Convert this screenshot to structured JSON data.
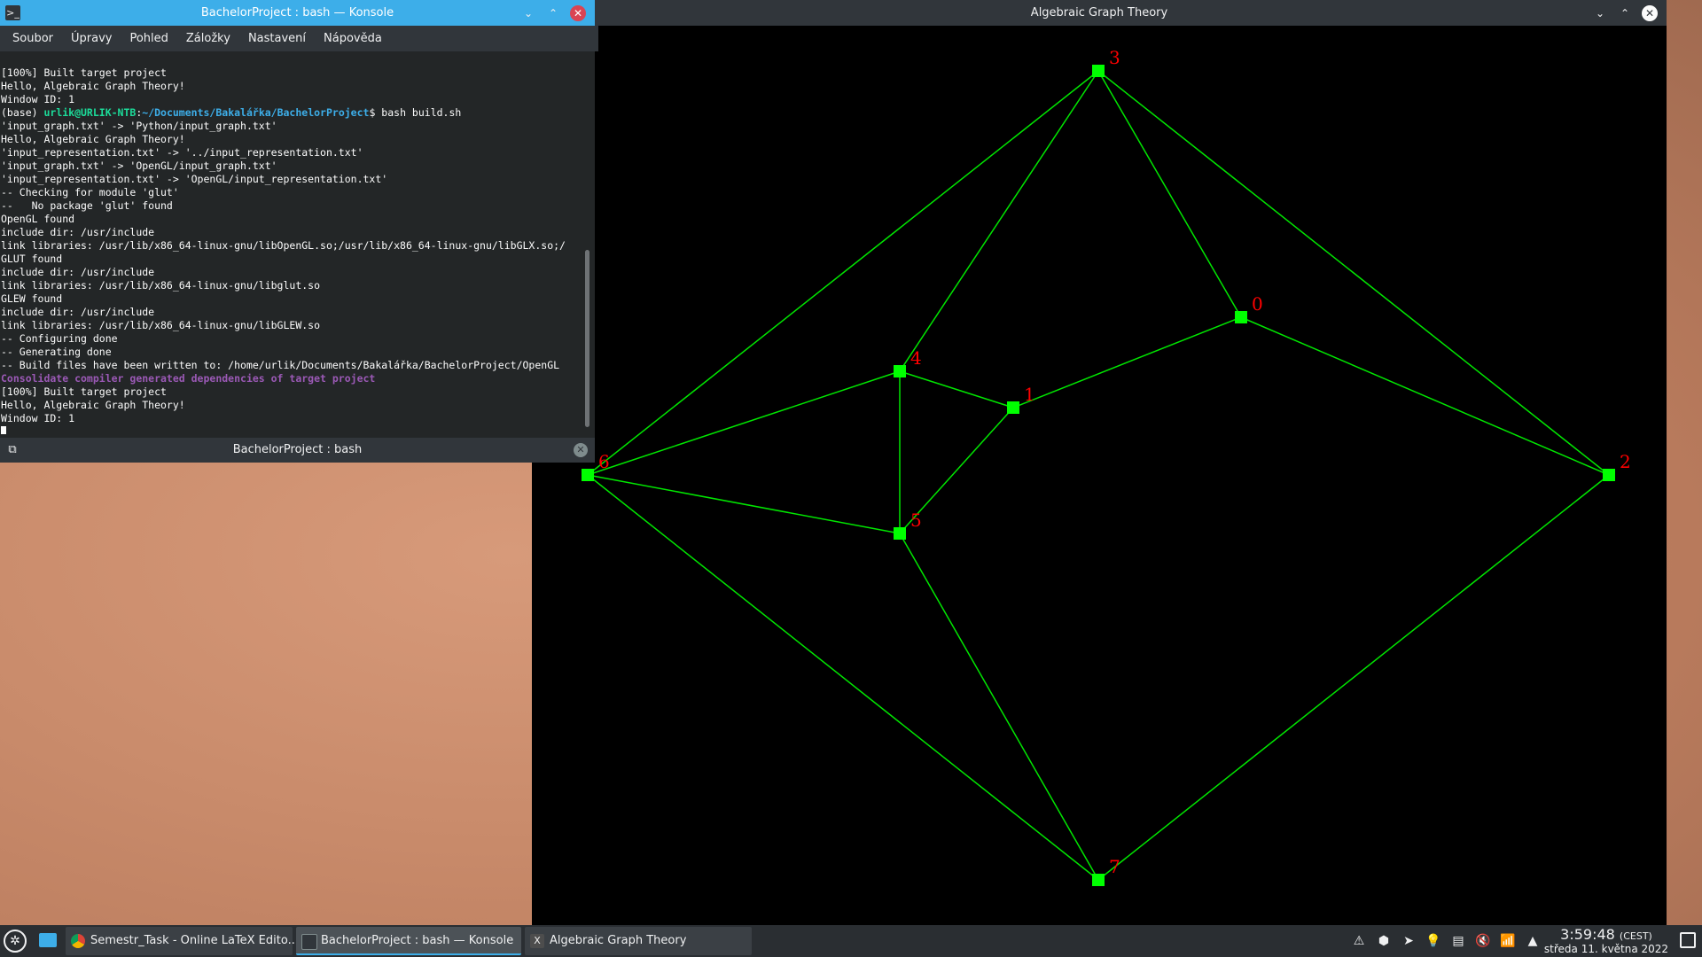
{
  "graph_window": {
    "title": "Algebraic Graph Theory",
    "minimize_glyph": "⌄",
    "maximize_glyph": "⌃",
    "close_glyph": "✕",
    "edge_color": "#00e600",
    "node_color": "#00ff00",
    "label_color": "#ff0000",
    "graph": {
      "nodes": [
        {
          "id": "0",
          "label": "0"
        },
        {
          "id": "1",
          "label": "1"
        },
        {
          "id": "2",
          "label": "2"
        },
        {
          "id": "3",
          "label": "3"
        },
        {
          "id": "4",
          "label": "4"
        },
        {
          "id": "5",
          "label": "5"
        },
        {
          "id": "6",
          "label": "6"
        },
        {
          "id": "7",
          "label": "7"
        }
      ],
      "edges": [
        [
          "3",
          "6"
        ],
        [
          "3",
          "4"
        ],
        [
          "3",
          "0"
        ],
        [
          "3",
          "2"
        ],
        [
          "0",
          "1"
        ],
        [
          "0",
          "2"
        ],
        [
          "4",
          "1"
        ],
        [
          "4",
          "6"
        ],
        [
          "4",
          "5"
        ],
        [
          "1",
          "5"
        ],
        [
          "6",
          "5"
        ],
        [
          "6",
          "7"
        ],
        [
          "5",
          "7"
        ],
        [
          "2",
          "7"
        ]
      ]
    }
  },
  "konsole": {
    "title": "BachelorProject : bash — Konsole",
    "app_icon": ">_",
    "menu": [
      "Soubor",
      "Úpravy",
      "Pohled",
      "Záložky",
      "Nastavení",
      "Nápověda"
    ],
    "tab_label": "BachelorProject : bash",
    "tab_close_glyph": "✕",
    "newtab_glyph": "⧉",
    "terminal": {
      "pre_lines": [
        "[100%] Built target project",
        "Hello, Algebraic Graph Theory!",
        "Window ID: 1"
      ],
      "prompt_prefix": "(base) ",
      "prompt_user": "urlik@URLIK-NTB",
      "prompt_sep": ":",
      "prompt_path": "~/Documents/Bakalářka/BachelorProject",
      "prompt_command": "$ bash build.sh",
      "mid_lines": [
        "'input_graph.txt' -> 'Python/input_graph.txt'",
        "Hello, Algebraic Graph Theory!",
        "'input_representation.txt' -> '../input_representation.txt'",
        "'input_graph.txt' -> 'OpenGL/input_graph.txt'",
        "'input_representation.txt' -> 'OpenGL/input_representation.txt'",
        "-- Checking for module 'glut'",
        "--   No package 'glut' found",
        "OpenGL found",
        "include dir: /usr/include",
        "link libraries: /usr/lib/x86_64-linux-gnu/libOpenGL.so;/usr/lib/x86_64-linux-gnu/libGLX.so;/",
        "GLUT found",
        "include dir: /usr/include",
        "link libraries: /usr/lib/x86_64-linux-gnu/libglut.so",
        "GLEW found",
        "include dir: /usr/include",
        "link libraries: /usr/lib/x86_64-linux-gnu/libGLEW.so",
        "-- Configuring done",
        "-- Generating done",
        "-- Build files have been written to: /home/urlik/Documents/Bakalářka/BachelorProject/OpenGL"
      ],
      "purple_line": "Consolidate compiler generated dependencies of target project",
      "post_lines": [
        "[100%] Built target project",
        "Hello, Algebraic Graph Theory!",
        "Window ID: 1"
      ]
    }
  },
  "taskbar": {
    "launcher_glyph": "✲",
    "tasks": [
      {
        "label": "Semestr_Task - Online LaTeX Edito...",
        "icon": "chrome-icon"
      },
      {
        "label": "BachelorProject : bash — Konsole",
        "icon": "konsole-icon"
      },
      {
        "label": "Algebraic Graph Theory",
        "icon": "x-window-icon",
        "icon_glyph": "X"
      }
    ],
    "tray_glyphs": [
      "⚠",
      "⬢",
      "➤",
      "💡",
      "▤",
      "🔇",
      "📶",
      "▲"
    ],
    "clock": {
      "time": "3:59:48",
      "zone": "(CEST)",
      "date": "středa 11. května 2022"
    }
  }
}
